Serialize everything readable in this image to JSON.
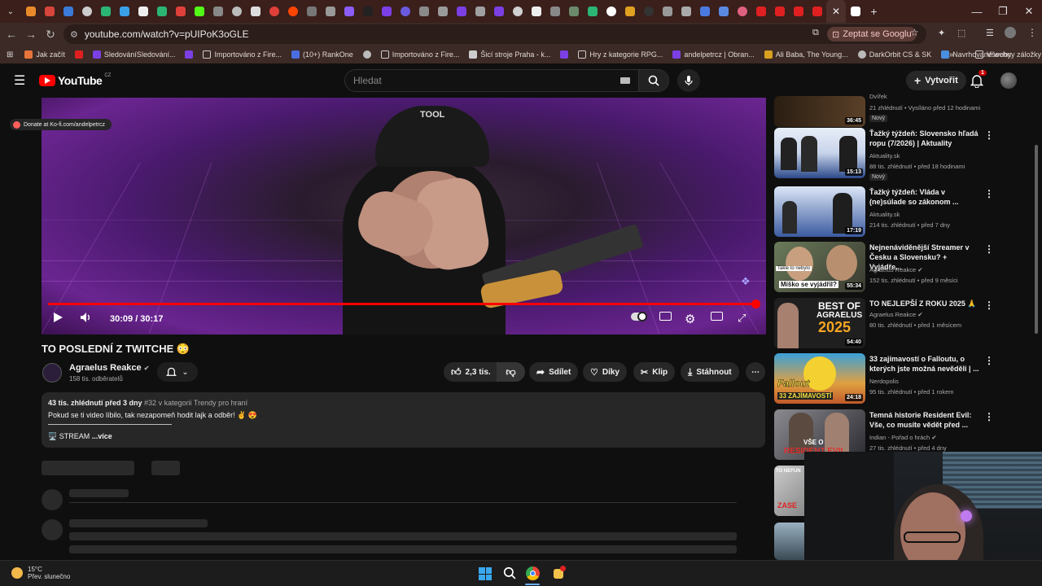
{
  "browser": {
    "url": "youtube.com/watch?v=pUIPoK3oGLE",
    "ask_google": "Zeptat se Googlu",
    "bookmarks": [
      {
        "label": "Jak začít",
        "color": "#e8743b"
      },
      {
        "label": "SledováníSledování...",
        "color": "#7b3fe4"
      },
      {
        "label": "Importováno z Fire...",
        "color": "#888888"
      },
      {
        "label": "(10+) RankOne",
        "color": "#4a6ee0"
      },
      {
        "label": "Importováno z Fire...",
        "color": "#888888"
      },
      {
        "label": "Šicí stroje Praha - k...",
        "color": "#cccccc"
      },
      {
        "label": "Hry z kategorie RPG...",
        "color": "#6a3fd0"
      },
      {
        "label": "andelpetrcz | Obran...",
        "color": "#7b3fe4"
      },
      {
        "label": "Ali Baba, The Young...",
        "color": "#d6a020"
      },
      {
        "label": "DarkOrbit CS & SK",
        "color": "#bbbbbb"
      },
      {
        "label": "Navrhované weby",
        "color": "#4a8ee0"
      }
    ],
    "all_bookmarks": "Všechny záložky"
  },
  "youtube": {
    "logo_text": "YouTube",
    "region": "CZ",
    "search_placeholder": "Hledat",
    "create_label": "Vytvořit",
    "notification_count": "1"
  },
  "player": {
    "kofi": "Donate at Ko-fi.com/andelpetrcz",
    "time": "30:09 / 30:17",
    "progress": 0.996
  },
  "video": {
    "title": "TO POSLEDNÍ Z TWITCHE 😳",
    "channel": "Agraelus Reakce",
    "subscribers": "158 tis. odběratelů",
    "likes": "2,3 tis.",
    "share": "Sdílet",
    "thanks": "Díky",
    "clip": "Klip",
    "download": "Stáhnout",
    "desc_meta": "43 tis. zhlédnutí  před 3 dny",
    "desc_tags": "#32 v kategorii Trendy pro hraní",
    "desc_text": "Pokud se ti video líbilo, tak nezapomeň hodit lajk a odběr! ✌️ 😍",
    "desc_stream": "🖥️ STREAM",
    "desc_more": "...více"
  },
  "recommendations": [
    {
      "title": "",
      "channel": "Dvířek",
      "meta": "21 zhlédnutí • Vysíláno před 12 hodinami",
      "badge": "Nový",
      "duration": "36:45",
      "color": "#3a2a1a"
    },
    {
      "title": "Ťažký týždeň: Slovensko hľadá ropu (7/2026) | Aktuality",
      "channel": "Aktuality.sk",
      "meta": "88 tis. zhlédnutí • před 18 hodinami",
      "badge": "Nový",
      "duration": "15:13",
      "color": "#2d4a8a"
    },
    {
      "title": "Ťažký týždeň: Vláda v (ne)súlade so zákonom ...",
      "channel": "Aktuality.sk",
      "meta": "214 tis. zhlédnutí • před 7 dny",
      "badge": "",
      "duration": "17:19",
      "color": "#3b5aa0"
    },
    {
      "title": "Nejnenáviděnější Streamer v Česku a Slovensku? + Vyjádře...",
      "channel": "Agraelus Reakce",
      "meta": "152 tis. zhlédnutí • před 9 měsíci",
      "badge": "",
      "duration": "55:34",
      "color": "#5a5a4a"
    },
    {
      "title": "TO NEJLEPŠÍ Z ROKU 2025 🙏",
      "channel": "Agraelus Reakce",
      "meta": "80 tis. zhlédnutí • před 1 měsícem",
      "badge": "",
      "duration": "54:40",
      "color": "#444444"
    },
    {
      "title": "33 zajímavostí o Falloutu, o kterých jste možná nevěděli | ...",
      "channel": "Nerdopolis",
      "meta": "95 tis. zhlédnutí • před 1 rokem",
      "badge": "",
      "duration": "24:18",
      "color": "#c0582a"
    },
    {
      "title": "Temná historie Resident Evil: Vše, co musíte vědět před ...",
      "channel": "Indian - Pořad o hrách",
      "meta": "27 tis. zhlédnutí • před 4 dny",
      "badge": "",
      "duration": "",
      "color": "#4a4a52"
    }
  ],
  "rec_thumb_text": {
    "thumb4_caption": "Míško se vyjádřil?",
    "thumb4_caption2": "Takle to nebylo",
    "thumb5_line1": "BEST OF",
    "thumb5_line2": "AGRAELUS",
    "thumb5_line3": "2025",
    "thumb6_line1": "Fallout",
    "thumb6_line2": "33 ZAJÍMAVOSTÍ",
    "thumb7_line1": "VŠE O",
    "thumb7_line2": "RESIDENT EVIL",
    "thumb8_line1": "TO NEFUN",
    "thumb8_line2": "ZASE"
  },
  "taskbar": {
    "temp": "15°C",
    "weather": "Přev. slunečno"
  }
}
